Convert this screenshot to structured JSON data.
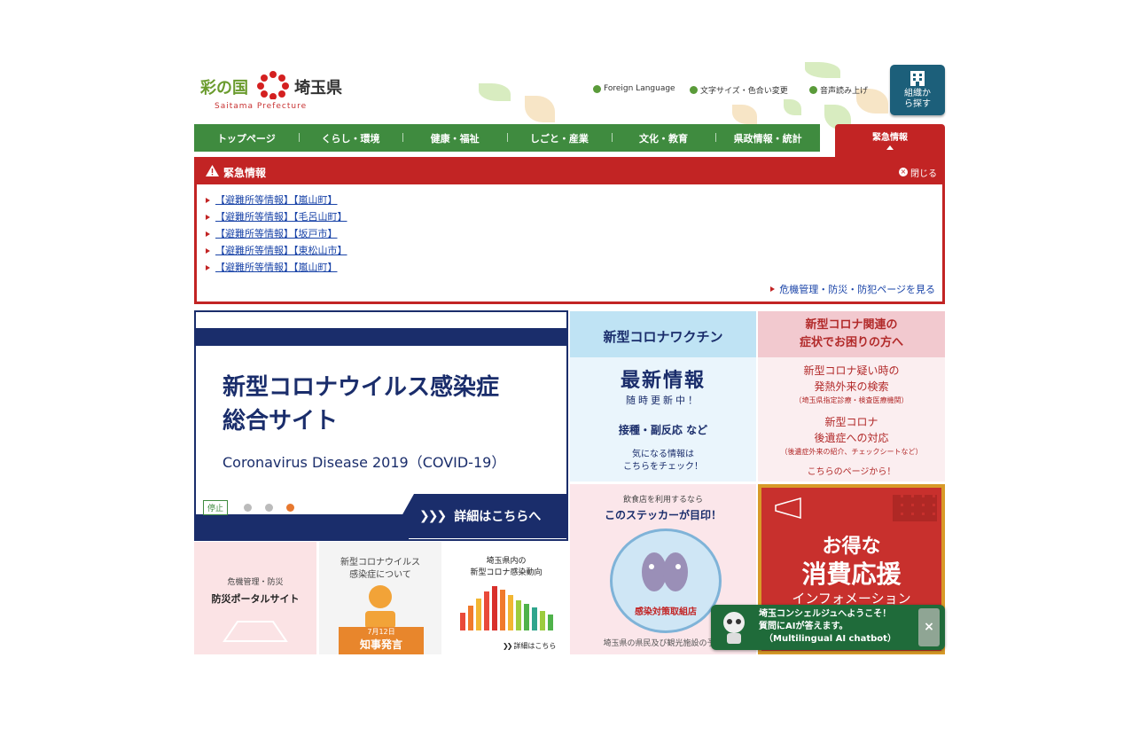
{
  "header": {
    "logo_name_colored": "彩の国",
    "logo_name": "埼玉県",
    "logo_sub": "Saitama Prefecture",
    "foreign_language": "Foreign Language",
    "font_size_color": "文字サイズ・色合い変更",
    "read_aloud": "音声読み上げ",
    "org_search": "組織から探す"
  },
  "nav": {
    "items": [
      "トップページ",
      "くらし・環境",
      "健康・福祉",
      "しごと・産業",
      "文化・教育",
      "県政情報・統計"
    ],
    "emergency_tab": "緊急情報"
  },
  "emergency": {
    "title": "緊急情報",
    "close": "閉じる",
    "items": [
      "【避難所等情報】【嵐山町】",
      "【避難所等情報】【毛呂山町】",
      "【避難所等情報】【坂戸市】",
      "【避難所等情報】【東松山市】",
      "【避難所等情報】【嵐山町】"
    ],
    "crisis_link": "危機管理・防災・防犯ページを見る"
  },
  "hero": {
    "title_line1": "新型コロナウイルス感染症",
    "title_line2": "総合サイト",
    "subtitle": "Coronavirus Disease 2019（COVID-19）",
    "cta": "詳細はこちらへ",
    "stop": "停止"
  },
  "banners": {
    "vaccine": {
      "head": "新型コロナワクチン",
      "line1": "最新情報",
      "line2": "随時更新中！",
      "line3": "接種・副反応 など",
      "line4": "気になる情報は",
      "line5": "こちらをチェック！"
    },
    "symptoms": {
      "head1": "新型コロナ関連の",
      "head2": "症状でお困りの方へ",
      "line1": "新型コロナ疑い時の",
      "line2": "発熱外来の検索",
      "line3": "（埼玉県指定診療・検査医療機関）",
      "line4": "新型コロナ",
      "line5": "後遺症への対応",
      "line6": "（後遺症外来の紹介、チェックシートなど）",
      "line7": "こちらのページから！"
    },
    "sticker": {
      "line1": "飲食店を利用するなら",
      "line2": "このステッカーが目印！",
      "badge": "感染対策取組店",
      "foot": "埼玉県の県民及び観光施設の予約"
    },
    "deal": {
      "line1": "お得な",
      "line2": "消費応援",
      "line3": "インフォメーション"
    },
    "disaster": {
      "line1": "危機管理・防災",
      "line2": "防災ポータルサイト"
    },
    "governor": {
      "line1": "新型コロナウイルス",
      "line2": "感染症について",
      "date": "7月12日",
      "label": "知事発言"
    },
    "trend": {
      "line1": "埼玉県内の",
      "line2": "新型コロナ感染動向",
      "more": "詳細はこちら"
    }
  },
  "chatbot": {
    "line1": "埼玉コンシェルジュへようこそ！",
    "line2": "質問にAIが答えます。",
    "line3": "（Multilingual AI chatbot）"
  }
}
